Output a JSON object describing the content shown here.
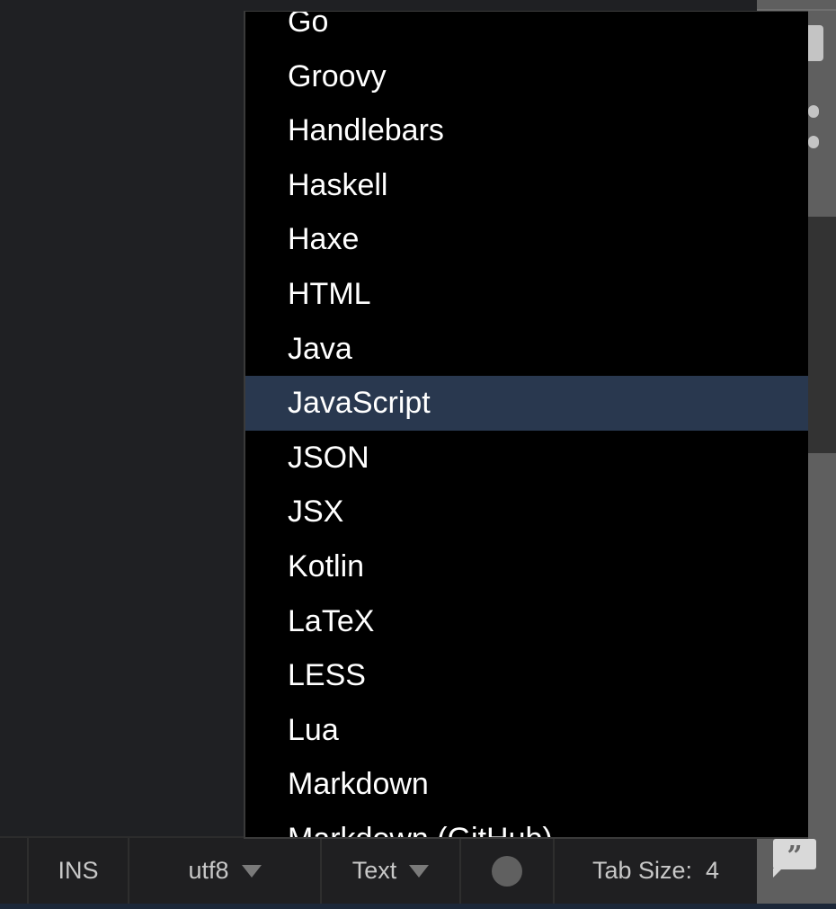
{
  "language_menu": {
    "items": [
      "Go",
      "Groovy",
      "Handlebars",
      "Haskell",
      "Haxe",
      "HTML",
      "Java",
      "JavaScript",
      "JSON",
      "JSX",
      "Kotlin",
      "LaTeX",
      "LESS",
      "Lua",
      "Markdown",
      "Markdown (GitHub)"
    ],
    "selected": "JavaScript"
  },
  "statusbar": {
    "mode": "INS",
    "encoding": "utf8",
    "language": "Text",
    "tab_size_label": "Tab Size:",
    "tab_size": "4"
  },
  "colors": {
    "highlight": "#29384f",
    "menu_bg": "#000000",
    "statusbar_bg": "#1f1f21"
  }
}
